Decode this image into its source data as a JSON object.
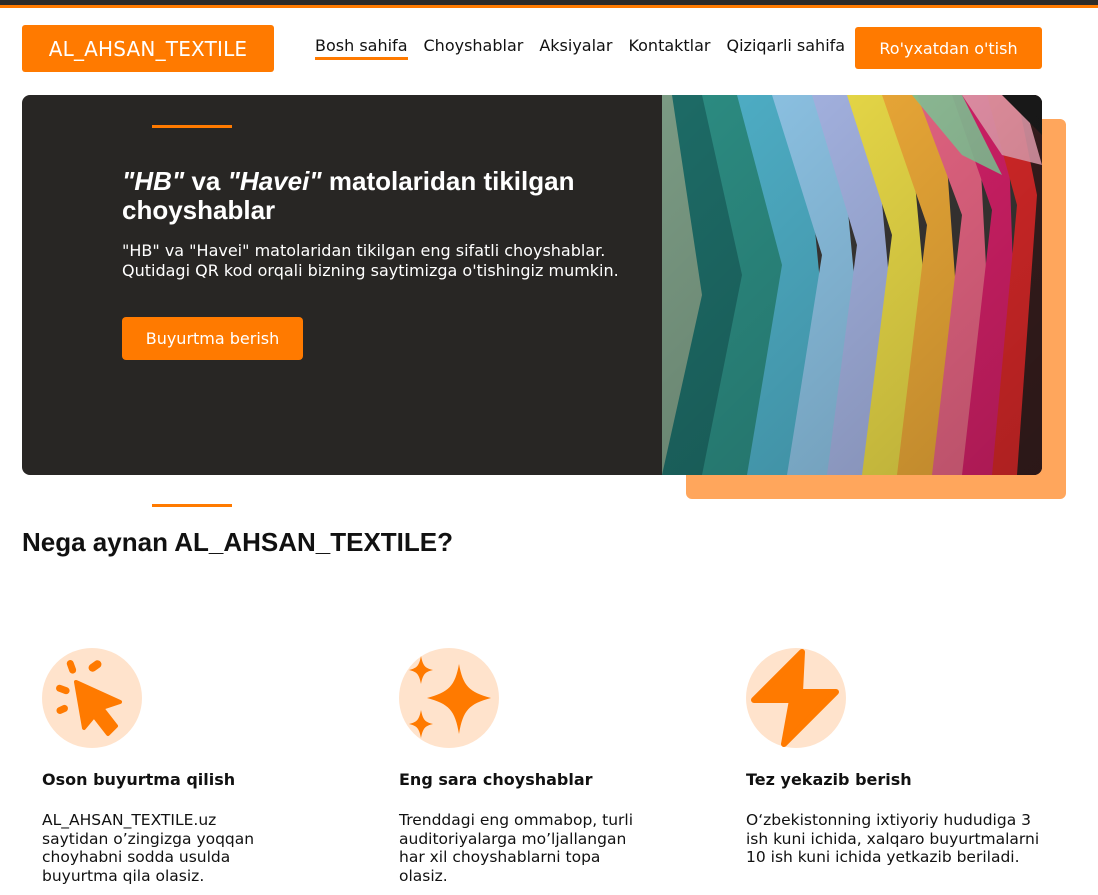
{
  "header": {
    "logo": "AL_AHSAN_TEXTILE",
    "nav": [
      "Bosh sahifa",
      "Choyshablar",
      "Aksiyalar",
      "Kontaktlar",
      "Qiziqarli sahifa"
    ],
    "register_label": "Ro'yxatdan o'tish"
  },
  "hero": {
    "title_q1": "\"HB\"",
    "title_mid": " va ",
    "title_q2": "\"Havei\"",
    "title_rest": " matolaridan tikilgan choyshablar",
    "text": "\"HB\" va \"Havei\" matolaridan tikilgan eng sifatli choyshablar. Qutidagi QR kod orqali bizning saytimizga o'tishingiz mumkin.",
    "button": "Buyurtma berish"
  },
  "section": {
    "title": "Nega aynan AL_AHSAN_TEXTILE?"
  },
  "features": [
    {
      "icon": "cursor-click-icon",
      "title": "Oson buyurtma qilish",
      "text": "AL_AHSAN_TEXTILE.uz saytidan o’zingizga yoqqan choyhabni sodda usulda buyurtma qila olasiz."
    },
    {
      "icon": "sparkle-icon",
      "title": "Eng sara choyshablar",
      "text": "Trenddagi eng ommabop, turli auditoriyalarga mo’ljallangan har xil choyshablarni topa olasiz."
    },
    {
      "icon": "lightning-icon",
      "title": "Tez yekazib berish",
      "text": "O‘zbekistonning ixtiyoriy hududiga 3 ish kuni ichida, xalqaro buyurtmalarni 10 ish kuni ichida yetkazib beriladi."
    }
  ],
  "colors": {
    "accent": "#ff7a00",
    "accent_light": "#ffa65c",
    "hero_bg": "#282624"
  }
}
